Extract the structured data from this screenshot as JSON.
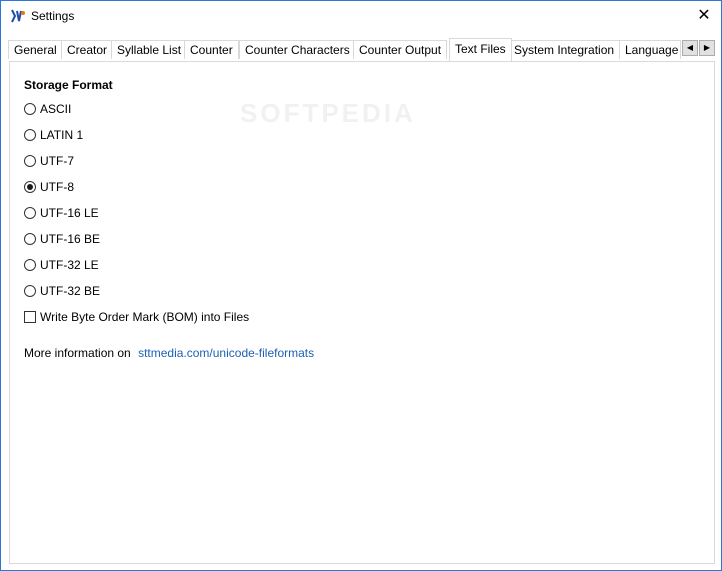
{
  "window": {
    "title": "Settings"
  },
  "tabs": [
    {
      "label": "General"
    },
    {
      "label": "Creator"
    },
    {
      "label": "Syllable List"
    },
    {
      "label": "Counter"
    },
    {
      "label": "Counter Characters"
    },
    {
      "label": "Counter Output"
    },
    {
      "label": "Text Files"
    },
    {
      "label": "System Integration"
    },
    {
      "label": "Language"
    }
  ],
  "active_tab": "Text Files",
  "storage": {
    "title": "Storage Format",
    "options": [
      {
        "label": "ASCII",
        "checked": false
      },
      {
        "label": "LATIN 1",
        "checked": false
      },
      {
        "label": "UTF-7",
        "checked": false
      },
      {
        "label": "UTF-8",
        "checked": true
      },
      {
        "label": "UTF-16 LE",
        "checked": false
      },
      {
        "label": "UTF-16 BE",
        "checked": false
      },
      {
        "label": "UTF-32 LE",
        "checked": false
      },
      {
        "label": "UTF-32 BE",
        "checked": false
      }
    ],
    "bom": {
      "label": "Write Byte Order Mark (BOM) into Files",
      "checked": false
    }
  },
  "info": {
    "text": "More information on",
    "link": "sttmedia.com/unicode-fileformats"
  },
  "watermark": "SOFTPEDIA",
  "colors": {
    "accent": "#2b79d6",
    "link": "#1e5fb4"
  }
}
